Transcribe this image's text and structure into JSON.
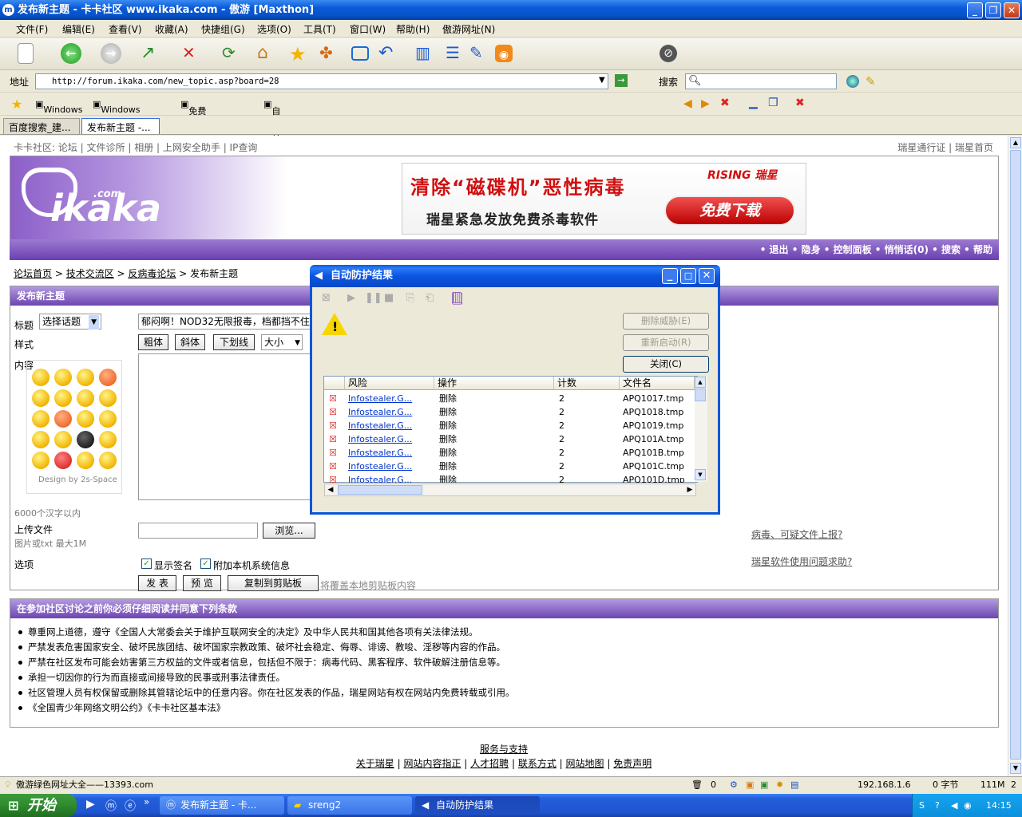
{
  "window": {
    "title": "发布新主题 - 卡卡社区 www.ikaka.com - 傲游 [Maxthon]"
  },
  "menu": [
    "文件(F)",
    "编辑(E)",
    "查看(V)",
    "收藏(A)",
    "快捷组(G)",
    "选项(O)",
    "工具(T)",
    "窗口(W)",
    "帮助(H)",
    "傲游网址(N)"
  ],
  "address": {
    "label": "地址",
    "url": "http://forum.ikaka.com/new_topic.asp?board=28",
    "search_label": "搜索"
  },
  "links": [
    "Windows",
    "Windows Media",
    "免费 Hotmail",
    "自定义链接"
  ],
  "tabs": [
    "百度搜索_建...",
    "发布新主题 -..."
  ],
  "site": {
    "topnav_left": "卡卡社区: 论坛 | 文件诊所 | 相册 | 上网安全助手 | IP查询",
    "topnav_right": "瑞星通行证 | 瑞星首页",
    "logo": "ikaka",
    "logo_sup": ".com",
    "banner_title": "清除“磁碟机”恶性病毒",
    "banner_brand": "RISING 瑞星",
    "banner_sub": "瑞星紧急发放免费杀毒软件",
    "banner_button": "免费下载",
    "nav_items": "• 退出  • 隐身  • 控制面板  • 悄悄话(0)  • 搜索  • 帮助",
    "breadcrumb": [
      "论坛首页",
      "技术交流区",
      "反病毒论坛",
      "发布新主题"
    ]
  },
  "form": {
    "header": "发布新主题",
    "title_label": "标题",
    "topic_select": "选择话题",
    "title_value": "郁闷啊！NOD32无限报毒，档都挡不住",
    "style_label": "样式",
    "bold": "粗体",
    "italic": "斜体",
    "underline": "下划线",
    "size": "大小",
    "content_label": "内容",
    "design_credit": "Design by 2s-Space",
    "char_limit": "6000个汉字以内",
    "upload_label": "上传文件",
    "upload_hint": "图片或txt 最大1M",
    "browse": "浏览...",
    "options_label": "选项",
    "show_sig": "显示签名",
    "attach_sys": "附加本机系统信息",
    "submit": "发 表",
    "preview": "预 览",
    "copy": "复制到剪贴板",
    "copy_hint": "将覆盖本地剪贴板内容",
    "link_virus": "病毒、可疑文件上报?",
    "link_help": "瑞星软件使用问题求助?"
  },
  "rules": {
    "header": "在参加社区讨论之前你必须仔细阅读并同意下列条款",
    "items": [
      "尊重网上道德，遵守《全国人大常委会关于维护互联网安全的决定》及中华人民共和国其他各项有关法律法规。",
      "严禁发表危害国家安全、破坏民族团结、破坏国家宗教政策、破坏社会稳定、侮辱、诽谤、教唆、淫秽等内容的作品。",
      "严禁在社区发布可能会妨害第三方权益的文件或者信息，包括但不限于：病毒代码、黑客程序、软件破解注册信息等。",
      "承担一切因你的行为而直接或间接导致的民事或刑事法律责任。",
      "社区管理人员有权保留或删除其管辖论坛中的任意内容。你在社区发表的作品，瑞星网站有权在网站内免费转载或引用。",
      "《全国青少年网络文明公约》《卡卡社区基本法》"
    ]
  },
  "footer": {
    "service": "服务与支持",
    "links": [
      "关于瑞星",
      "网站内容指正",
      "人才招聘",
      "联系方式",
      "网站地图",
      "免责声明"
    ]
  },
  "dialog": {
    "title": "自动防护结果",
    "btn_delete": "删除威胁(E)",
    "btn_restart": "重新启动(R)",
    "btn_close": "关闭(C)",
    "columns": [
      "风险",
      "操作",
      "计数",
      "文件名"
    ],
    "rows": [
      {
        "risk": "Infostealer.G...",
        "action": "删除",
        "count": "2",
        "file": "APQ1017.tmp"
      },
      {
        "risk": "Infostealer.G...",
        "action": "删除",
        "count": "2",
        "file": "APQ1018.tmp"
      },
      {
        "risk": "Infostealer.G...",
        "action": "删除",
        "count": "2",
        "file": "APQ1019.tmp"
      },
      {
        "risk": "Infostealer.G...",
        "action": "删除",
        "count": "2",
        "file": "APQ101A.tmp"
      },
      {
        "risk": "Infostealer.G...",
        "action": "删除",
        "count": "2",
        "file": "APQ101B.tmp"
      },
      {
        "risk": "Infostealer.G...",
        "action": "删除",
        "count": "2",
        "file": "APQ101C.tmp"
      },
      {
        "risk": "Infostealer.G...",
        "action": "删除",
        "count": "2",
        "file": "APQ101D.tmp"
      }
    ]
  },
  "status": {
    "text": "傲游绿色网址大全——13393.com",
    "count": "0",
    "ip": "192.168.1.6",
    "bytes": "0 字节",
    "mem": "111M",
    "num": "2"
  },
  "taskbar": {
    "start": "开始",
    "tasks": [
      "发布新主题 - 卡...",
      "sreng2",
      "自动防护结果"
    ],
    "time": "14:15"
  },
  "colors": {
    "accent": "#6d45b2",
    "xp_blue": "#0a56d8"
  }
}
